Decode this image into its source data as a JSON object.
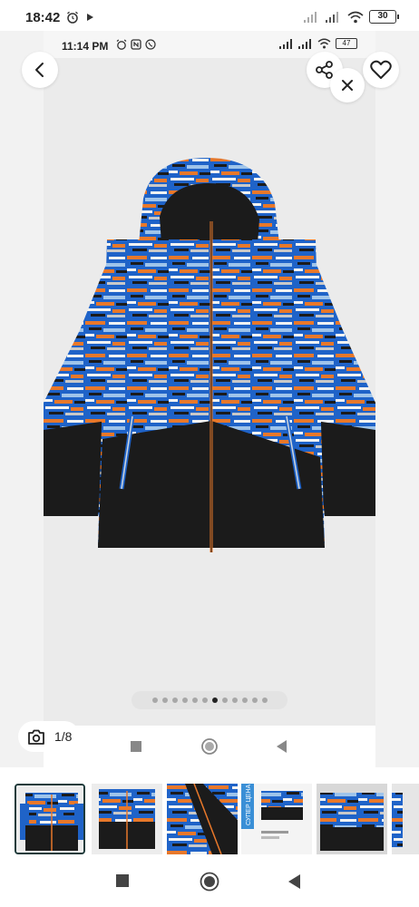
{
  "status_bar": {
    "time": "18:42",
    "battery": "30",
    "icons": [
      "alarm-icon",
      "play-icon",
      "signal-icon",
      "signal-icon",
      "wifi-icon",
      "battery-icon"
    ]
  },
  "inner_status_bar": {
    "time": "11:14 PM",
    "battery": "47",
    "icons": [
      "alarm-icon",
      "nfc-icon",
      "viber-icon",
      "signal-icon",
      "signal-icon",
      "wifi-icon",
      "battery-icon"
    ]
  },
  "product": {
    "image": "kids-winter-jacket-image",
    "colors": {
      "blue": "#1f63c8",
      "orange": "#e8782a",
      "black": "#1b1b1b",
      "white": "#f2f2f2"
    }
  },
  "actions": {
    "back": "back-arrow-icon",
    "share": "share-icon",
    "favorite": "heart-icon",
    "close": "close-icon"
  },
  "gallery": {
    "counter": "1/8",
    "page_count": 12,
    "active_page": 6
  },
  "thumbnails": [
    {
      "name": "thumb-front"
    },
    {
      "name": "thumb-front-small"
    },
    {
      "name": "thumb-detail"
    },
    {
      "name": "thumb-screenshot"
    },
    {
      "name": "thumb-folded"
    },
    {
      "name": "thumb-partial"
    }
  ],
  "thumb_promo_text": "СУПЕР ЦЕНА"
}
